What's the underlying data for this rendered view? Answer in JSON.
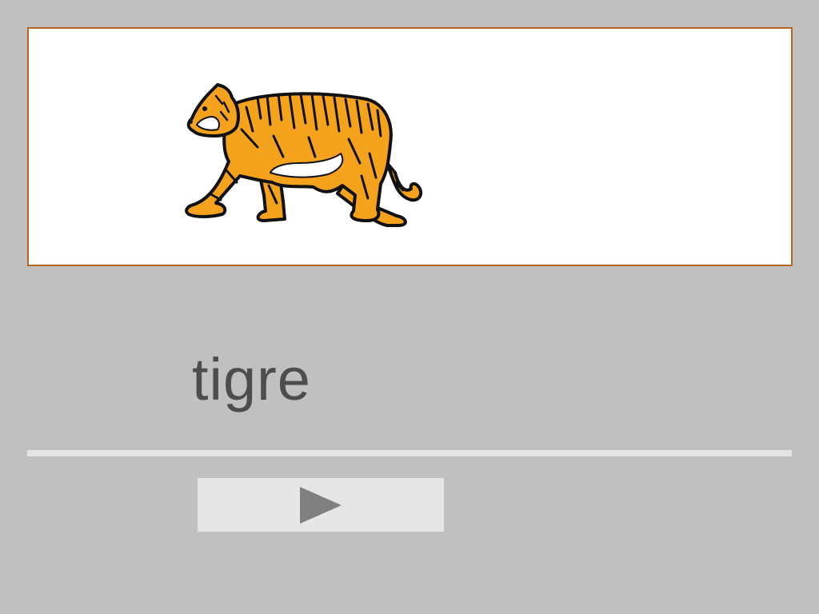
{
  "card": {
    "image_icon": "tiger-illustration",
    "border_color": "#b5651d"
  },
  "word": {
    "text": "tigre"
  },
  "controls": {
    "next_icon": "play-icon"
  },
  "colors": {
    "background": "#c0c0c0",
    "tiger_orange": "#f5a21c",
    "text": "#4d4d4d",
    "button": "#e6e6e6",
    "icon": "#808080"
  }
}
